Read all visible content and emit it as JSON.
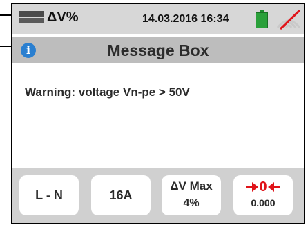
{
  "status_bar": {
    "mode_label": "ΔV%",
    "datetime": "14.03.2016 16:34",
    "battery_color": "#2aa03a",
    "signal_icon": "no-signal-icon"
  },
  "message_box": {
    "title": "Message Box",
    "info_icon_glyph": "i",
    "message": "Warning: voltage Vn-pe > 50V"
  },
  "soft_keys": [
    {
      "label": "L - N"
    },
    {
      "label": "16A"
    },
    {
      "title": "ΔV Max",
      "value": "4%"
    },
    {
      "zero_label": "0",
      "value": "0.000",
      "accent_color": "#e0141a"
    }
  ]
}
